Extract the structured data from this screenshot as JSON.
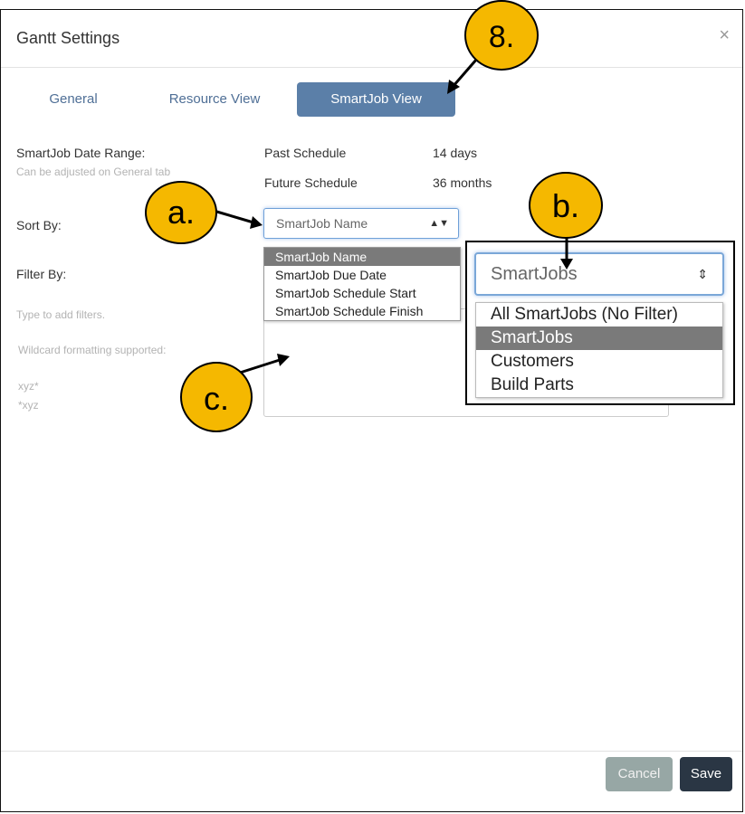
{
  "dialog": {
    "title": "Gantt Settings",
    "close_symbol": "×"
  },
  "tabs": [
    {
      "label": "General",
      "active": false
    },
    {
      "label": "Resource View",
      "active": false
    },
    {
      "label": "SmartJob View",
      "active": true
    }
  ],
  "date_range": {
    "label": "SmartJob Date Range:",
    "hint": "Can be adjusted on General tab",
    "past_label": "Past Schedule",
    "past_value": "14 days",
    "future_label": "Future Schedule",
    "future_value": "36 months"
  },
  "sort_by": {
    "label": "Sort By:",
    "selected": "SmartJob Name",
    "options": [
      "SmartJob Name",
      "SmartJob Due Date",
      "SmartJob Schedule Start",
      "SmartJob Schedule Finish"
    ]
  },
  "filter_by": {
    "label": "Filter By:",
    "hint_type": "Type to add filters.",
    "hint_wildcard": "Wildcard formatting supported:",
    "example_1": "xyz*",
    "example_2": "*xyz",
    "selected": "SmartJobs",
    "options": [
      "All SmartJobs (No Filter)",
      "SmartJobs",
      "Customers",
      "Build Parts"
    ]
  },
  "footer": {
    "cancel_label": "Cancel",
    "save_label": "Save"
  },
  "callouts": {
    "step": "8.",
    "a": "a.",
    "b": "b.",
    "c": "c."
  },
  "colors": {
    "callout_fill": "#f5b800",
    "active_tab": "#5b7fa8",
    "save_button": "#2a3644",
    "cancel_button": "#97a7a5"
  }
}
